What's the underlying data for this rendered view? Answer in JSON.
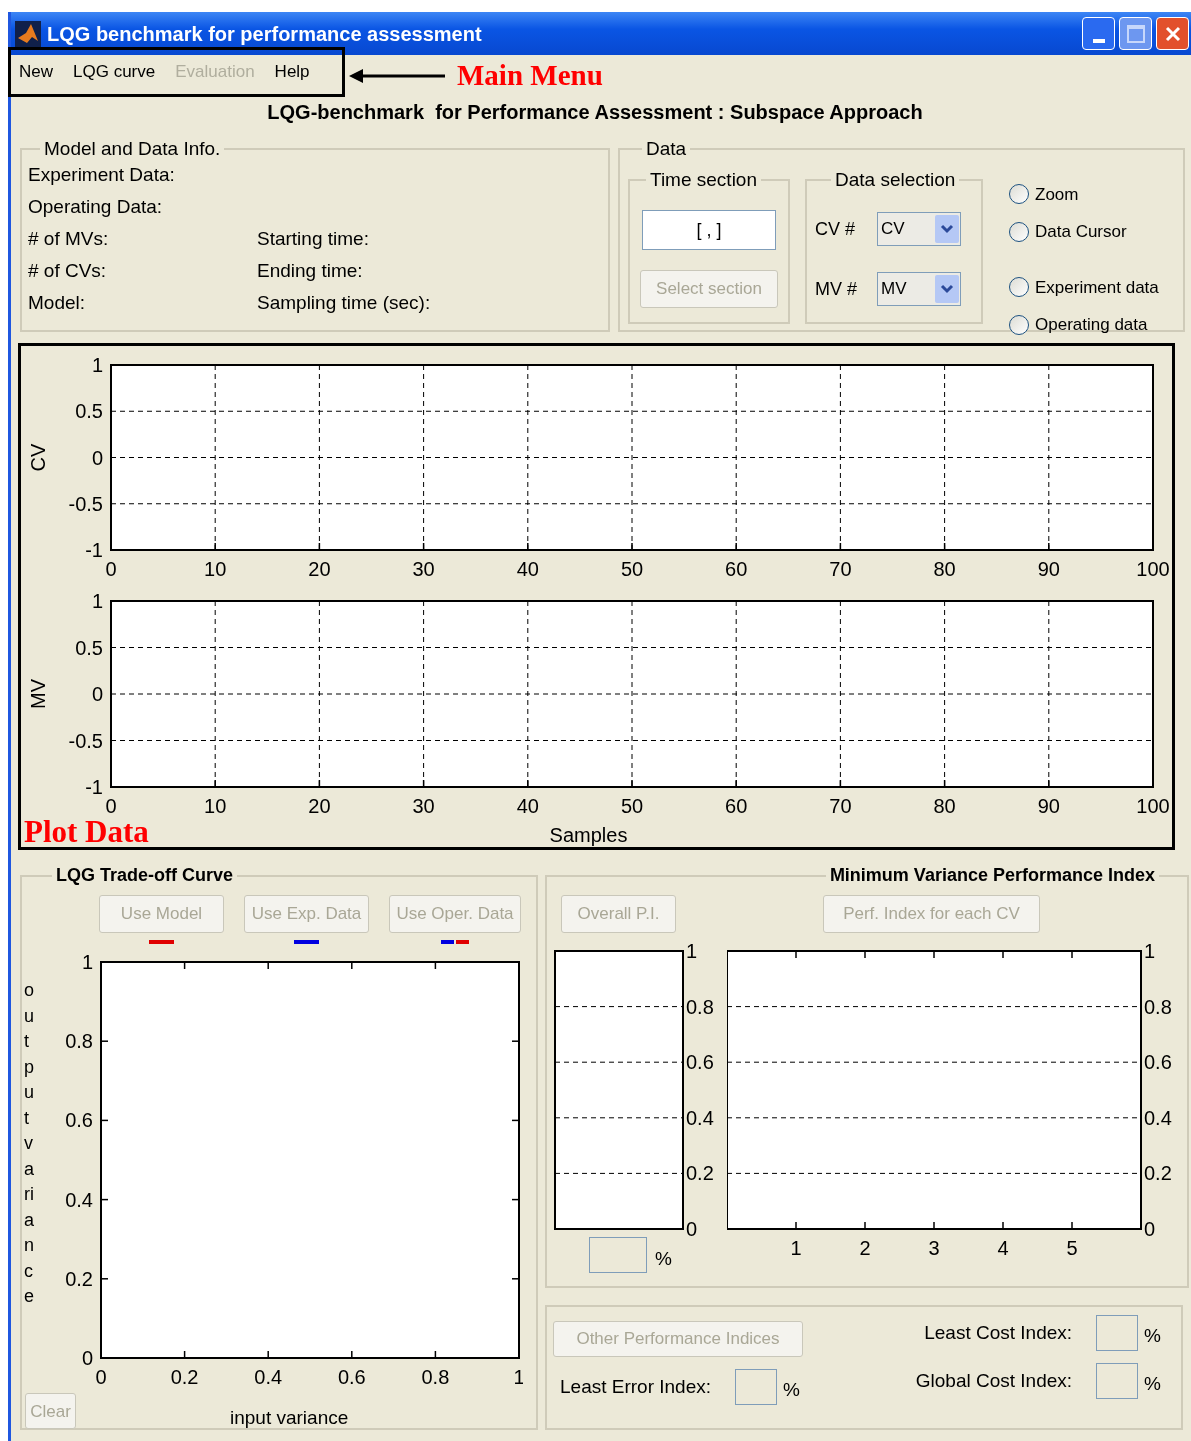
{
  "window": {
    "title": "LQG benchmark for performance assessment"
  },
  "menu": [
    {
      "label": "New",
      "disabled": false
    },
    {
      "label": "LQG curve",
      "disabled": false
    },
    {
      "label": "Evaluation",
      "disabled": true
    },
    {
      "label": "Help",
      "disabled": false
    }
  ],
  "menu_annotation": "Main Menu",
  "heading": "LQG-benchmark  for Performance Assessment : Subspace Approach",
  "model_info": {
    "title": "Model and Data Info.",
    "left_labels": [
      "Experiment Data:",
      "Operating Data:",
      "# of MVs:",
      "# of CVs:",
      "Model:"
    ],
    "right_labels": [
      "Starting time:",
      "Ending time:",
      "Sampling time (sec):"
    ]
  },
  "data_panel": {
    "title": "Data",
    "time_section": {
      "title": "Time section",
      "value": "[ , ]",
      "button": {
        "label": "Select section",
        "disabled": true
      }
    },
    "data_selection": {
      "title": "Data selection",
      "rows": [
        {
          "label": "CV #",
          "value": "CV"
        },
        {
          "label": "MV #",
          "value": "MV"
        }
      ]
    },
    "view_modes": [
      {
        "label": "Zoom",
        "selected": false
      },
      {
        "label": "Data Cursor",
        "selected": false
      }
    ],
    "data_sources": [
      {
        "label": "Experiment data",
        "selected": false
      },
      {
        "label": "Operating data",
        "selected": false
      }
    ]
  },
  "plot": {
    "annotation": "Plot Data",
    "charts": [
      {
        "ylabel": "CV",
        "ytick_labels": [
          "1",
          "0.5",
          "0",
          "-0.5",
          "-1"
        ],
        "xtick_labels": [
          "0",
          "10",
          "20",
          "30",
          "40",
          "50",
          "60",
          "70",
          "80",
          "90",
          "100"
        ]
      },
      {
        "ylabel": "MV",
        "ytick_labels": [
          "1",
          "0.5",
          "0",
          "-0.5",
          "-1"
        ],
        "xtick_labels": [
          "0",
          "10",
          "20",
          "30",
          "40",
          "50",
          "60",
          "70",
          "80",
          "90",
          "100"
        ],
        "xlabel": "Samples"
      }
    ]
  },
  "tradeoff": {
    "title": "LQG Trade-off Curve",
    "buttons": [
      {
        "label": "Use Model",
        "disabled": true,
        "legend_marks": [
          {
            "color": "#e00000"
          }
        ]
      },
      {
        "label": "Use Exp. Data",
        "disabled": true,
        "legend_marks": [
          {
            "color": "#0000e0"
          }
        ]
      },
      {
        "label": "Use Oper. Data",
        "disabled": true,
        "legend_marks": [
          {
            "color": "#0000e0"
          },
          {
            "color": "#e00000"
          }
        ]
      }
    ],
    "chart": {
      "ylabel": "output variance",
      "ytick_labels": [
        "1",
        "0.8",
        "0.6",
        "0.4",
        "0.2",
        "0"
      ],
      "xtick_labels": [
        "0",
        "0.2",
        "0.4",
        "0.6",
        "0.8",
        "1"
      ],
      "xlabel": "input variance"
    },
    "clear_button": {
      "label": "Clear",
      "disabled": true
    }
  },
  "mvpi": {
    "title": "Minimum Variance Performance Index",
    "buttons": [
      {
        "label": "Overall P.I.",
        "disabled": true
      },
      {
        "label": "Perf. Index for each CV",
        "disabled": true
      }
    ],
    "overall_chart": {
      "ytick_labels": [
        "1",
        "0.8",
        "0.6",
        "0.4",
        "0.2",
        "0"
      ]
    },
    "overall_unit": "%",
    "cv_chart": {
      "ytick_labels": [
        "1",
        "0.8",
        "0.6",
        "0.4",
        "0.2",
        "0"
      ],
      "xtick_labels": [
        "1",
        "2",
        "3",
        "4",
        "5"
      ]
    }
  },
  "other": {
    "button": {
      "label": "Other Performance Indices",
      "disabled": true
    },
    "left_fields": [
      {
        "label": "Least Error Index:",
        "unit": "%"
      }
    ],
    "right_fields": [
      {
        "label": "Least Cost Index:",
        "unit": "%"
      },
      {
        "label": "Global Cost Index:",
        "unit": "%"
      }
    ]
  }
}
